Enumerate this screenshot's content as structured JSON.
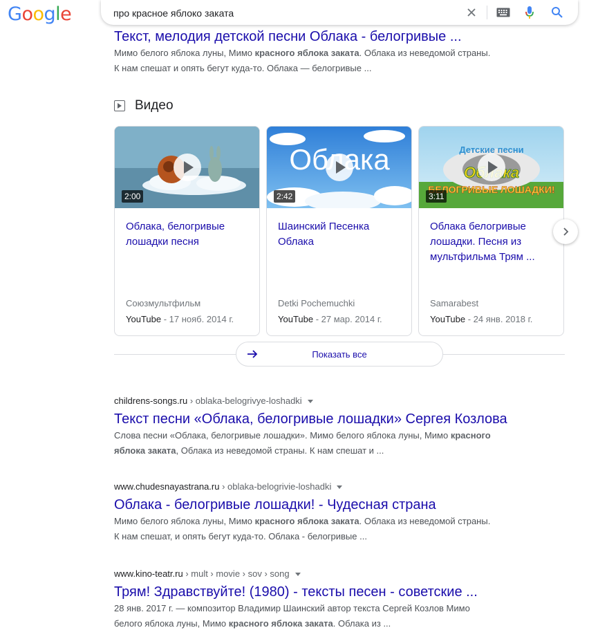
{
  "header": {
    "logo": [
      "G",
      "o",
      "o",
      "g",
      "l",
      "e"
    ],
    "logo_colors": [
      "#4285f4",
      "#ea4335",
      "#fbbc05",
      "#4285f4",
      "#34a853",
      "#ea4335"
    ],
    "query": "про красное яблоко заката"
  },
  "top_result": {
    "title": "Текст, мелодия детской песни Облака - белогривые ...",
    "snippet_1a": "Мимо белого яблока луны, Мимо ",
    "snippet_1b": "красного яблока заката",
    "snippet_1c": ". Облака из неведомой страны.",
    "snippet_2": "К нам спешат и опять бегут куда-то. Облака — белогривые ..."
  },
  "videos": {
    "heading": "Видео",
    "items": [
      {
        "duration": "2:00",
        "title": "Облака, белогривые лошадки песня",
        "channel": "Союзмультфильм",
        "source": "YouTube",
        "date": " - 17 нояб. 2014 г."
      },
      {
        "duration": "2:42",
        "title": "Шаинский Песенка Облака",
        "channel": "Detki Pochemuchki",
        "source": "YouTube",
        "date": " - 27 мар. 2014 г."
      },
      {
        "duration": "3:11",
        "title": "Облака белогривые лошадки. Песня из мультфильма Трям ...",
        "channel": "Samarabest",
        "source": "YouTube",
        "date": " - 24 янв. 2018 г."
      }
    ],
    "thumb2_text": "Облака",
    "thumb3_top": "Детские песни",
    "thumb3_mid": "Облака",
    "thumb3_bottom": "БЕЛОГРИВЫЕ ЛОШАДКИ!",
    "show_all": "Показать все"
  },
  "results": [
    {
      "domain": "childrens-songs.ru",
      "crumbs": " › oblaka-belogrivye-loshadki",
      "title": "Текст песни «Облака, белогривые лошадки» Сергея Козлова",
      "s1a": "Слова песни «Облака, белогривые лошадки». Мимо белого яблока луны, Мимо ",
      "s1b": "красного",
      "s2a": "яблока заката",
      "s2b": ", Облака из неведомой страны. К нам спешат и ..."
    },
    {
      "domain": "www.chudesnayastrana.ru",
      "crumbs": " › oblaka-belogrivie-loshadki",
      "title": "Облака - белогривые лошадки! - Чудесная страна",
      "s1a": "Мимо белого яблока луны, Мимо ",
      "s1b": "красного яблока заката",
      "s1c": ". Облака из неведомой страны.",
      "s2": "К нам спешат, и опять бегут куда-то. Облака - белогривые ..."
    },
    {
      "domain": "www.kino-teatr.ru",
      "crumbs": " › mult › movie › sov › song",
      "title": "Трям! Здравствуйте! (1980) - тексты песен - советские ...",
      "s1": "28 янв. 2017 г. — композитор Владимир Шаинский автор текста Сергей Козлов Мимо",
      "s2a": "белого яблока луны, Мимо ",
      "s2b": "красного яблока заката",
      "s2c": ". Облака из ..."
    }
  ]
}
